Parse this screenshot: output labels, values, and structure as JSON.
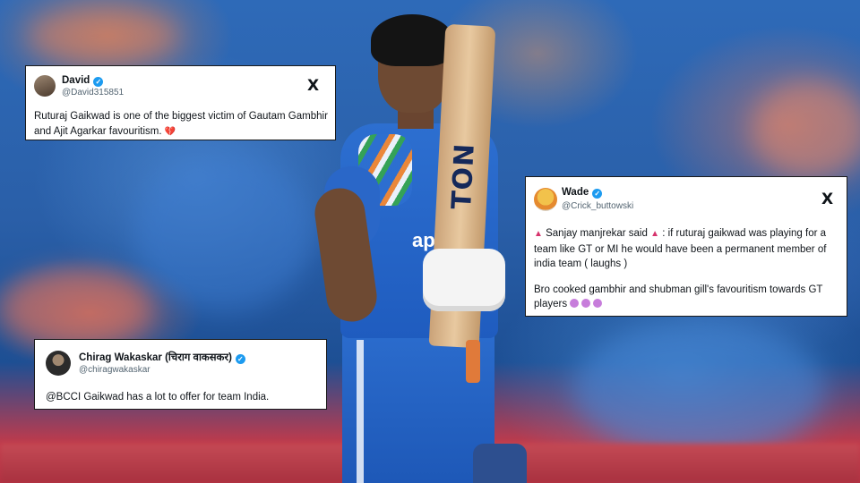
{
  "tweets": [
    {
      "name": "David",
      "handle": "@David315851",
      "text": "Ruturaj Gaikwad is one of the biggest victim of Gautam Gambhir and Ajit Agarkar favouritism.",
      "trailing_emoji": "broken-heart-icon",
      "verified": true,
      "x_logo": "X"
    },
    {
      "name": "Wade",
      "handle": "@Crick_buttowski",
      "paragraph1_a": "Sanjay manjrekar said",
      "paragraph1_b": ": if ruturaj gaikwad was playing for a team like GT or MI he would have been a permanent member of india team ( laughs )",
      "paragraph2": "Bro cooked gambhir and shubman gill's favouritism towards GT players",
      "verified": true,
      "x_logo": "X"
    },
    {
      "name": "Chirag Wakaskar (चिराग वाकसकर)",
      "handle": "@chiragwakaskar",
      "text": "@BCCI Gaikwad has a lot to offer for team India.",
      "verified": true
    }
  ],
  "background": {
    "bat_brand": "TON",
    "jersey_sponsor": "apollo"
  },
  "colors": {
    "verified": "#1d9bf0",
    "jersey": "#2d6fd0",
    "card_bg": "#ffffff"
  }
}
